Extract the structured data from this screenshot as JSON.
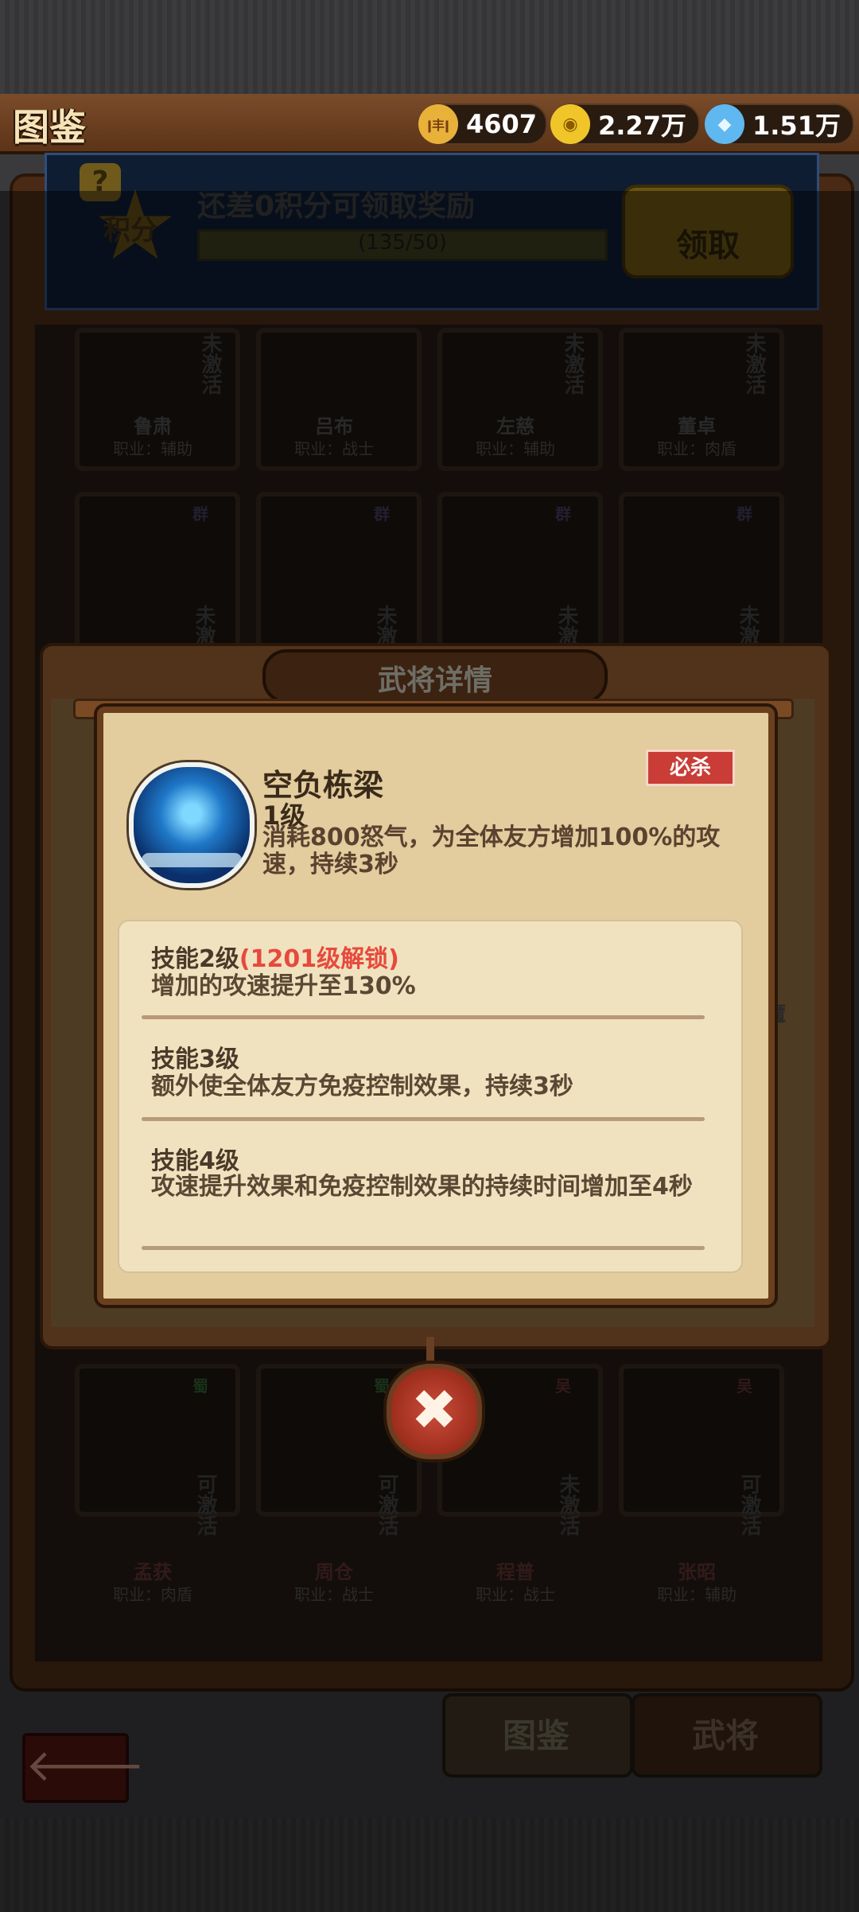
{
  "header": {
    "title": "图鉴",
    "currencies": [
      {
        "icon": "ticket-icon",
        "icon_text": "ǀ丰ǀ",
        "value": "4607"
      },
      {
        "icon": "coin-icon",
        "icon_text": "◉",
        "value": "2.27万"
      },
      {
        "icon": "diamond-icon",
        "icon_text": "◆",
        "value": "1.51万"
      }
    ]
  },
  "points": {
    "help": "?",
    "star_label": "积分",
    "message": "还差0积分可领取奖励",
    "progress_text": "(135/50)",
    "claim_label": "领取"
  },
  "cards_top": [
    {
      "name": "鲁肃",
      "job": "职业：辅助",
      "tag": "未激活"
    },
    {
      "name": "吕布",
      "job": "职业：战士",
      "tag": ""
    },
    {
      "name": "左慈",
      "job": "职业：辅助",
      "tag": "未激活"
    },
    {
      "name": "董卓",
      "job": "职业：肉盾",
      "tag": "未激活"
    }
  ],
  "cards_second": [
    {
      "faction": "群",
      "tag": "未激"
    },
    {
      "faction": "群",
      "tag": "未激"
    },
    {
      "faction": "群",
      "tag": "未激"
    },
    {
      "faction": "群",
      "tag": "未激"
    }
  ],
  "cards_bottom": [
    {
      "name": "孟获",
      "job": "职业：肉盾",
      "faction": "蜀",
      "tag": "可激活"
    },
    {
      "name": "周仓",
      "job": "职业：战士",
      "faction": "蜀",
      "tag": "可激活"
    },
    {
      "name": "程普",
      "job": "职业：战士",
      "faction": "吴",
      "tag": "未激活"
    },
    {
      "name": "张昭",
      "job": "职业：辅助",
      "faction": "吴",
      "tag": "可激活"
    }
  ],
  "modal": {
    "title": "武将详情",
    "skill": {
      "name": "空负栋梁",
      "level": "1级",
      "badge": "必杀",
      "desc": "消耗800怒气，为全体友方增加100%的攻速，持续3秒"
    },
    "tiers": [
      {
        "title": "技能2级",
        "lock": "(1201级解锁)",
        "desc": "增加的攻速提升至130%"
      },
      {
        "title": "技能3级",
        "lock": "",
        "desc": "额外使全体友方免疫控制效果，持续3秒"
      },
      {
        "title": "技能4级",
        "lock": "",
        "desc": "攻速提升效果和免疫控制效果的持续时间增加至4秒"
      }
    ],
    "close_icon": "✖"
  },
  "tabs": {
    "handbook": "图鉴",
    "generals": "武将",
    "back_icon": "🡐"
  },
  "side_char": "魔"
}
